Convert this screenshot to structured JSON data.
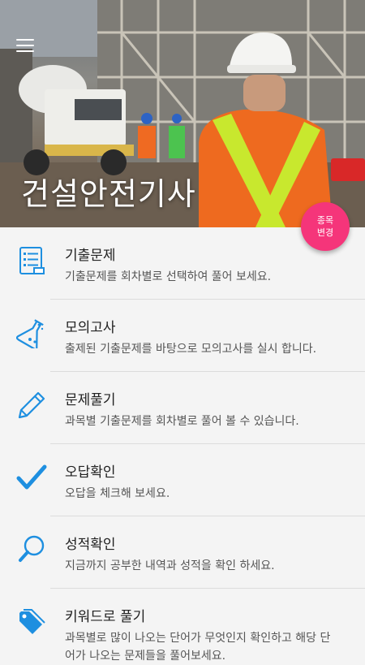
{
  "header": {
    "title": "건설안전기사",
    "menu_icon": "hamburger-menu-icon"
  },
  "fab": {
    "label": "종목 변경",
    "color": "#f5357a"
  },
  "accent_color": "#1e8fe0",
  "menu": [
    {
      "title": "기출문제",
      "desc": "기출문제를 회차별로 선택하여 풀어 보세요.",
      "icon": "document-list-icon"
    },
    {
      "title": "모의고사",
      "desc": "출제된 기출문제를 바탕으로 모의고사를 실시 합니다.",
      "icon": "flask-icon"
    },
    {
      "title": "문제풀기",
      "desc": "과목별 기출문제를 회차별로 풀어 볼 수 있습니다.",
      "icon": "pencil-icon"
    },
    {
      "title": "오답확인",
      "desc": "오답을 체크해 보세요.",
      "icon": "checkmark-icon"
    },
    {
      "title": "성적확인",
      "desc": "지금까지 공부한 내역과 성적을 확인 하세요.",
      "icon": "magnifier-icon"
    },
    {
      "title": "키워드로 풀기",
      "desc": "과목별로 많이 나오는 단어가 무엇인지 확인하고 해당 단어가 나오는 문제들을 풀어보세요.",
      "icon": "tags-icon"
    }
  ]
}
